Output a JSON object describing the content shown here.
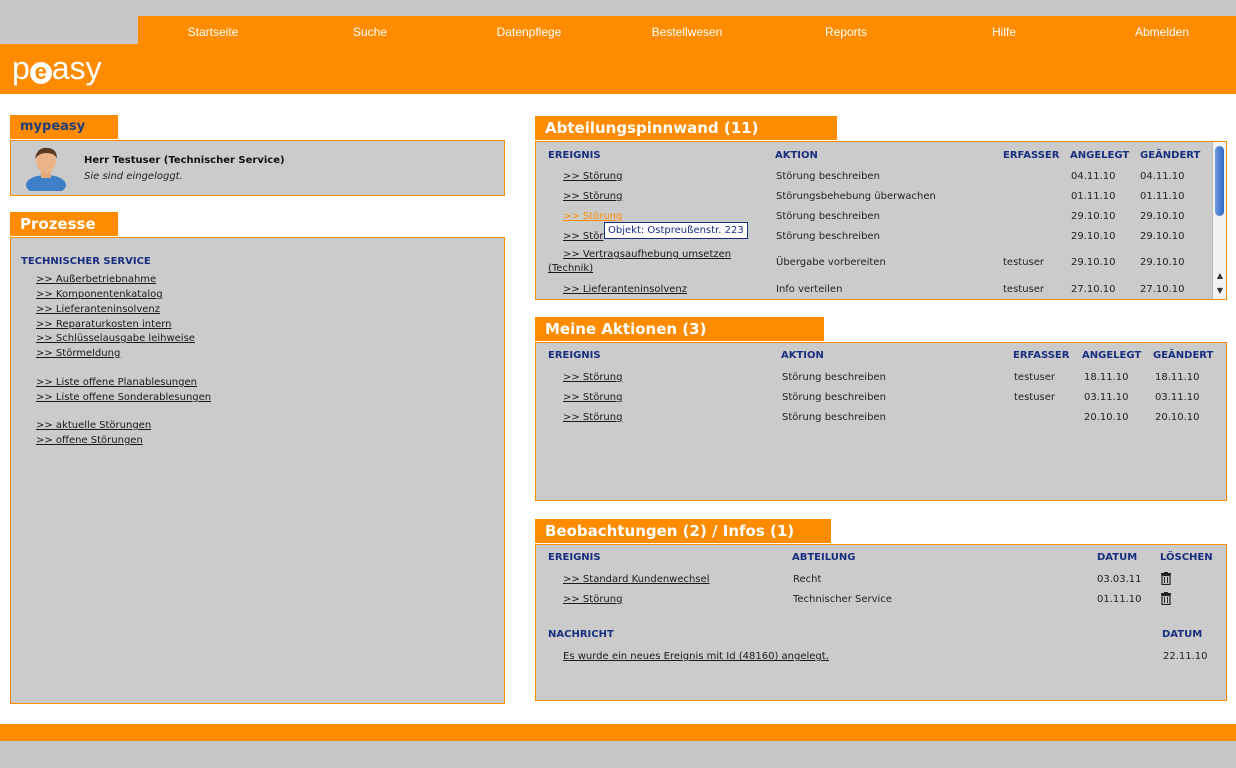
{
  "nav": {
    "items": [
      "Startseite",
      "Suche",
      "Datenpflege",
      "Bestellwesen",
      "Reports",
      "Hilfe",
      "Abmelden"
    ]
  },
  "logo": {
    "p": "p",
    "e": "e",
    "rest": "asy"
  },
  "mypeasy": {
    "title": "mypeasy",
    "user_name": "Herr Testuser (Technischer Service)",
    "status": "Sie sind eingeloggt."
  },
  "prozesse": {
    "title": "Prozesse",
    "section_heading": "TECHNISCHER SERVICE",
    "group1": [
      ">> Außerbetriebnahme",
      ">> Komponentenkatalog",
      ">> Lieferanteninsolvenz",
      ">> Reparaturkosten intern",
      ">> Schlüsselausgabe leihweise",
      ">> Störmeldung"
    ],
    "group2": [
      ">> Liste offene Planablesungen",
      ">> Liste offene Sonderablesungen"
    ],
    "group3": [
      ">> aktuelle Störungen",
      ">> offene Störungen"
    ]
  },
  "pinnwand": {
    "title": "Abteilungspinnwand (11)",
    "headers": {
      "ereignis": "EREIGNIS",
      "aktion": "AKTION",
      "erfasser": "ERFASSER",
      "angelegt": "ANGELEGT",
      "geaendert": "GEÄNDERT"
    },
    "rows": [
      {
        "ereignis": ">> Störung",
        "aktion": "Störung beschreiben",
        "erfasser": "",
        "angelegt": "04.11.10",
        "geaendert": "04.11.10"
      },
      {
        "ereignis": ">> Störung",
        "aktion": "Störungsbehebung überwachen",
        "erfasser": "",
        "angelegt": "01.11.10",
        "geaendert": "01.11.10"
      },
      {
        "ereignis": ">> Störung",
        "aktion": "Störung beschreiben",
        "erfasser": "",
        "angelegt": "29.10.10",
        "geaendert": "29.10.10"
      },
      {
        "ereignis": ">> Stör",
        "aktion": "Störung beschreiben",
        "erfasser": "",
        "angelegt": "29.10.10",
        "geaendert": "29.10.10"
      },
      {
        "ereignis": ">> Vertragsaufhebung umsetzen",
        "ereignis2": "(Technik)",
        "aktion": "Übergabe vorbereiten",
        "erfasser": "testuser",
        "angelegt": "29.10.10",
        "geaendert": "29.10.10"
      },
      {
        "ereignis": ">> Lieferanteninsolvenz",
        "aktion": "Info verteilen",
        "erfasser": "testuser",
        "angelegt": "27.10.10",
        "geaendert": "27.10.10"
      }
    ],
    "tooltip": "Objekt: Ostpreußenstr. 223"
  },
  "aktionen": {
    "title": "Meine Aktionen (3)",
    "headers": {
      "ereignis": "EREIGNIS",
      "aktion": "AKTION",
      "erfasser": "ERFASSER",
      "angelegt": "ANGELEGT",
      "geaendert": "GEÄNDERT"
    },
    "rows": [
      {
        "ereignis": ">> Störung",
        "aktion": "Störung beschreiben",
        "erfasser": "testuser",
        "angelegt": "18.11.10",
        "geaendert": "18.11.10"
      },
      {
        "ereignis": ">> Störung",
        "aktion": "Störung beschreiben",
        "erfasser": "testuser",
        "angelegt": "03.11.10",
        "geaendert": "03.11.10"
      },
      {
        "ereignis": ">> Störung",
        "aktion": "Störung beschreiben",
        "erfasser": "",
        "angelegt": "20.10.10",
        "geaendert": "20.10.10"
      }
    ]
  },
  "beobachtungen": {
    "title": "Beobachtungen (2) / Infos (1)",
    "headers": {
      "ereignis": "EREIGNIS",
      "abteilung": "ABTEILUNG",
      "datum": "DATUM",
      "loeschen": "LÖSCHEN"
    },
    "rows": [
      {
        "ereignis": ">> Standard Kundenwechsel",
        "abteilung": "Recht",
        "datum": "03.03.11"
      },
      {
        "ereignis": ">> Störung",
        "abteilung": "Technischer Service",
        "datum": "01.11.10"
      }
    ],
    "msg_headers": {
      "nachricht": "NACHRICHT",
      "datum": "DATUM"
    },
    "messages": [
      {
        "text": "Es wurde ein neues Ereignis mit Id (48160) angelegt.",
        "datum": "22.11.10"
      }
    ]
  },
  "colors": {
    "orange": "#ff8c00",
    "panel": "#cbcbcb",
    "heading_blue": "#1a2e80"
  }
}
